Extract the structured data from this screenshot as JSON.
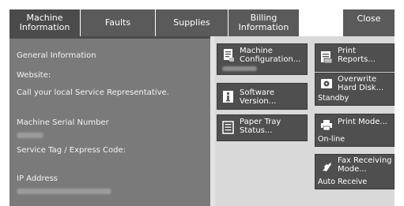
{
  "tabs": [
    {
      "label": "Machine\nInformation",
      "active": true
    },
    {
      "label": "Faults"
    },
    {
      "label": "Supplies"
    },
    {
      "label": "Billing\nInformation"
    }
  ],
  "close_label": "Close",
  "info": {
    "general_information": "General Information",
    "website_label": "Website:",
    "website_value": "Call your local Service Representative.",
    "serial_label": "Machine Serial Number",
    "service_tag_label": "Service Tag / Express Code:",
    "ip_label": "IP Address"
  },
  "buttons": {
    "machine_configuration": "Machine\nConfiguration...",
    "software_version": "Software\nVersion...",
    "paper_tray_status": "Paper Tray\nStatus...",
    "print_reports": "Print Reports...",
    "overwrite_hard_disk": "Overwrite\nHard Disk...",
    "overwrite_status": "Standby",
    "print_mode": "Print Mode...",
    "print_mode_status": "On-line",
    "fax_receiving_mode": "Fax Receiving\nMode...",
    "fax_receiving_status": "Auto Receive"
  },
  "colors": {
    "tab_bg": "#5a5a5a",
    "panel_bg": "#7a7a7a",
    "button_bg": "#4f4f4f",
    "screen_bg": "#d9d9d9"
  }
}
